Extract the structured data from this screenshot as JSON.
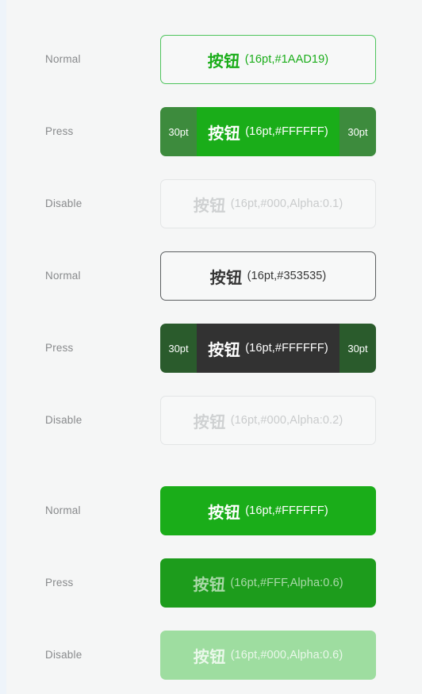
{
  "page": {
    "background": "#f5f6f6",
    "edge_strip_color": "#eef4fa",
    "accent_green": "#1AAD19",
    "dark_text": "#353535"
  },
  "groups": [
    {
      "name": "outline-green-button-group",
      "rows": [
        {
          "state_label": "Normal",
          "style": "outline-green",
          "cn_text": "按钮",
          "spec_text": "(16pt,#1AAD19)",
          "left_pad_label": "",
          "right_pad_label": ""
        },
        {
          "state_label": "Press",
          "style": "press green-press",
          "cn_text": "按钮",
          "spec_text": "(16pt,#FFFFFF)",
          "left_pad_label": "30pt",
          "right_pad_label": "30pt"
        },
        {
          "state_label": "Disable",
          "style": "outline-disabled",
          "cn_text": "按钮",
          "spec_text": "(16pt,#000,Alpha:0.1)",
          "left_pad_label": "",
          "right_pad_label": ""
        }
      ]
    },
    {
      "name": "outline-dark-button-group",
      "rows": [
        {
          "state_label": "Normal",
          "style": "outline-dark",
          "cn_text": "按钮",
          "spec_text": "(16pt,#353535)",
          "left_pad_label": "",
          "right_pad_label": ""
        },
        {
          "state_label": "Press",
          "style": "press dark-press",
          "cn_text": "按钮",
          "spec_text": "(16pt,#FFFFFF)",
          "left_pad_label": "30pt",
          "right_pad_label": "30pt"
        },
        {
          "state_label": "Disable",
          "style": "outline-disabled",
          "cn_text": "按钮",
          "spec_text": "(16pt,#000,Alpha:0.2)",
          "left_pad_label": "",
          "right_pad_label": ""
        }
      ]
    },
    {
      "name": "solid-green-button-group",
      "rows": [
        {
          "state_label": "Normal",
          "style": "solid-green",
          "cn_text": "按钮",
          "spec_text": "(16pt,#FFFFFF)",
          "left_pad_label": "",
          "right_pad_label": ""
        },
        {
          "state_label": "Press",
          "style": "solid-green-press",
          "cn_text": "按钮",
          "spec_text": "(16pt,#FFF,Alpha:0.6)",
          "left_pad_label": "",
          "right_pad_label": ""
        },
        {
          "state_label": "Disable",
          "style": "solid-green-disabled",
          "cn_text": "按钮",
          "spec_text": "(16pt,#000,Alpha:0.6)",
          "left_pad_label": "",
          "right_pad_label": ""
        }
      ]
    }
  ]
}
